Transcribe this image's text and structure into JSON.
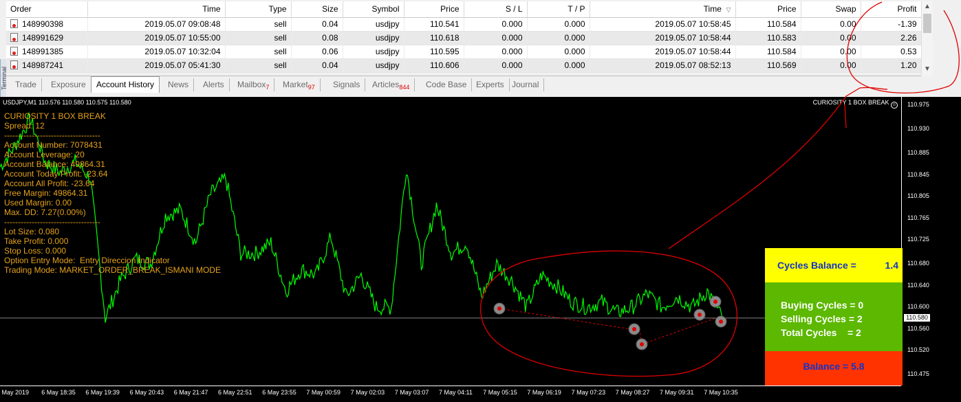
{
  "terminal": {
    "side_label": "Terminal",
    "columns": [
      "Order",
      "Time",
      "Type",
      "Size",
      "Symbol",
      "Price",
      "S / L",
      "T / P",
      "Time",
      "Price",
      "Swap",
      "Profit"
    ],
    "sort_indicator": "▽",
    "rows": [
      [
        "148990398",
        "2019.05.07 09:08:48",
        "sell",
        "0.04",
        "usdjpy",
        "110.541",
        "0.000",
        "0.000",
        "2019.05.07 10:58:45",
        "110.584",
        "0.00",
        "-1.39"
      ],
      [
        "148991629",
        "2019.05.07 10:55:00",
        "sell",
        "0.08",
        "usdjpy",
        "110.618",
        "0.000",
        "0.000",
        "2019.05.07 10:58:44",
        "110.583",
        "0.00",
        "2.26"
      ],
      [
        "148991385",
        "2019.05.07 10:32:04",
        "sell",
        "0.06",
        "usdjpy",
        "110.595",
        "0.000",
        "0.000",
        "2019.05.07 10:58:44",
        "110.584",
        "0.00",
        "0.53"
      ],
      [
        "148987241",
        "2019.05.07 05:41:30",
        "sell",
        "0.04",
        "usdjpy",
        "110.606",
        "0.000",
        "0.000",
        "2019.05.07 08:52:13",
        "110.569",
        "0.00",
        "1.20"
      ]
    ],
    "tabs": [
      {
        "label": "Trade",
        "badge": ""
      },
      {
        "label": "Exposure",
        "badge": ""
      },
      {
        "label": "Account History",
        "badge": ""
      },
      {
        "label": "News",
        "badge": ""
      },
      {
        "label": "Alerts",
        "badge": ""
      },
      {
        "label": "Mailbox",
        "badge": "7"
      },
      {
        "label": "Market",
        "badge": "97"
      },
      {
        "label": "Signals",
        "badge": ""
      },
      {
        "label": "Articles",
        "badge": "844"
      },
      {
        "label": "Code Base",
        "badge": ""
      },
      {
        "label": "Experts",
        "badge": ""
      },
      {
        "label": "Journal",
        "badge": ""
      }
    ],
    "active_tab": "Account History"
  },
  "chart": {
    "symbol_header": "USDJPY,M1  110.576 110.580 110.575 110.580",
    "ea_label": "CURIOSITY 1 BOX BREAK",
    "ea_icon": "smiley-icon",
    "current_price": "110.580",
    "info_lines": [
      "CURIOSITY 1 BOX BREAK",
      "Spread: 12",
      "-----------------------------------",
      "Account Number: 7078431",
      "Account Leverage: 20",
      "Account Balance: 49864.31",
      "Account Today Profit: -23.64",
      "Account All Profit: -23.64",
      "Free Margin: 49864.31",
      "Used Margin: 0.00",
      "Max. DD: 7.27(0.00%)",
      "-----------------------------------",
      "Lot Size: 0.080",
      "Take Profit: 0.000",
      "Stop Loss: 0.000",
      "Option Entry Mode:  Entry Direccion Indicator",
      "Trading Mode: MARKET_ORDER_BREAK_ISMANI MODE"
    ],
    "y_ticks": [
      "110.975",
      "110.930",
      "110.885",
      "110.845",
      "110.805",
      "110.765",
      "110.725",
      "110.680",
      "110.640",
      "110.600",
      "110.560",
      "110.520",
      "110.475"
    ],
    "x_ticks": [
      "6 May 2019",
      "6 May 18:35",
      "6 May 19:39",
      "6 May 20:43",
      "6 May 21:47",
      "6 May 22:51",
      "6 May 23:55",
      "7 May 00:59",
      "7 May 02:03",
      "7 May 03:07",
      "7 May 04:11",
      "7 May 05:15",
      "7 May 06:19",
      "7 May 07:23",
      "7 May 08:27",
      "7 May 09:31",
      "7 May 10:35"
    ],
    "y_range": [
      110.455,
      110.99
    ],
    "line_color": "#00ff00",
    "price_line_color": "#b0b0b0",
    "annotation_color": "#e00000"
  },
  "chart_data": {
    "type": "line",
    "series_anchor_y": [
      110.86,
      110.9,
      110.95,
      110.87,
      110.85,
      110.87,
      110.84,
      110.58,
      110.65,
      110.69,
      110.68,
      110.77,
      110.78,
      110.72,
      110.81,
      110.84,
      110.7,
      110.7,
      110.72,
      110.63,
      110.67,
      110.66,
      110.73,
      110.62,
      110.66,
      110.6,
      110.6,
      110.86,
      110.68,
      110.79,
      110.7,
      110.72,
      110.62,
      110.68,
      110.65,
      110.6,
      110.66,
      110.64,
      110.61,
      110.6,
      110.61,
      110.59,
      110.6,
      110.625,
      110.6,
      110.62,
      110.6,
      110.63,
      110.58
    ],
    "ylim": [
      110.455,
      110.99
    ]
  },
  "panel": {
    "cycles_balance_label": "Cycles Balance =",
    "cycles_balance_value": "1.4",
    "buying_cycles": "Buying Cycles = 0",
    "selling_cycles": "Selling Cycles = 2",
    "total_cycles": "Total Cycles    = 2",
    "balance": "Balance = 5.8",
    "colors": {
      "top": "#ffff00",
      "middle": "#5cb800",
      "bottom": "#ff3300",
      "text": "#1433c8"
    }
  }
}
